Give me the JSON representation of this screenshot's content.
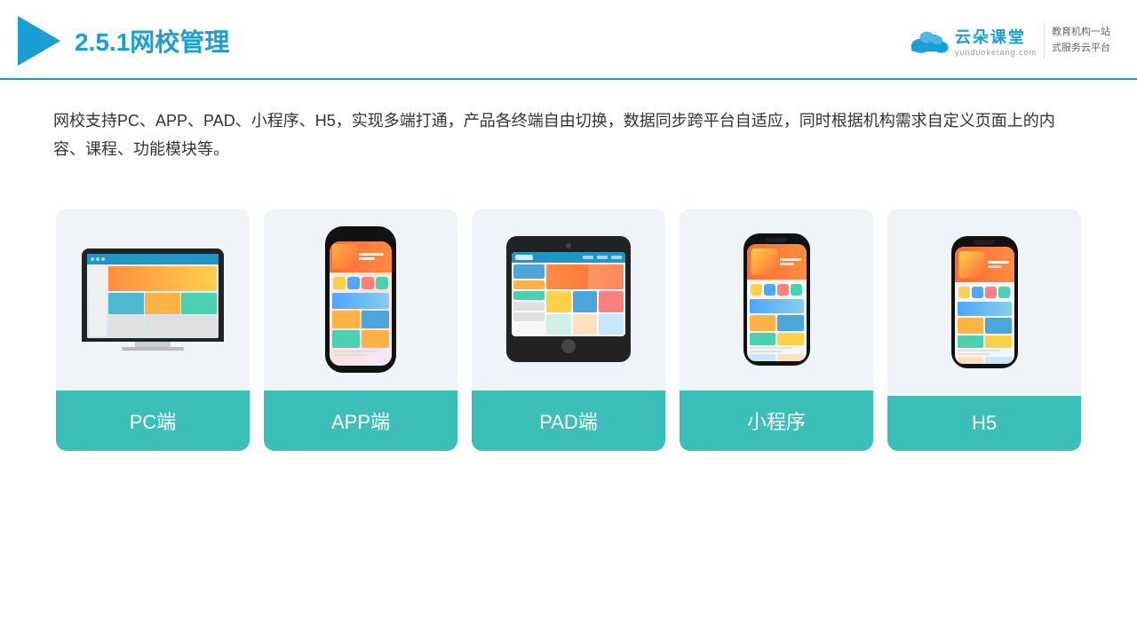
{
  "header": {
    "title_prefix": "2.5.1",
    "title_main": "网校管理",
    "brand_name": "云朵课堂",
    "brand_url": "yunduoketang.com",
    "brand_tagline_line1": "教育机构一站",
    "brand_tagline_line2": "式服务云平台"
  },
  "description": {
    "text": "网校支持PC、APP、PAD、小程序、H5，实现多端打通，产品各终端自由切换，数据同步跨平台自适应，同时根据机构需求自定义页面上的内容、课程、功能模块等。"
  },
  "cards": [
    {
      "id": "pc",
      "label": "PC端"
    },
    {
      "id": "app",
      "label": "APP端"
    },
    {
      "id": "pad",
      "label": "PAD端"
    },
    {
      "id": "miniprogram",
      "label": "小程序"
    },
    {
      "id": "h5",
      "label": "H5"
    }
  ],
  "colors": {
    "accent": "#1a9fd4",
    "teal": "#3bbfb8",
    "header_border": "#2196c4"
  }
}
